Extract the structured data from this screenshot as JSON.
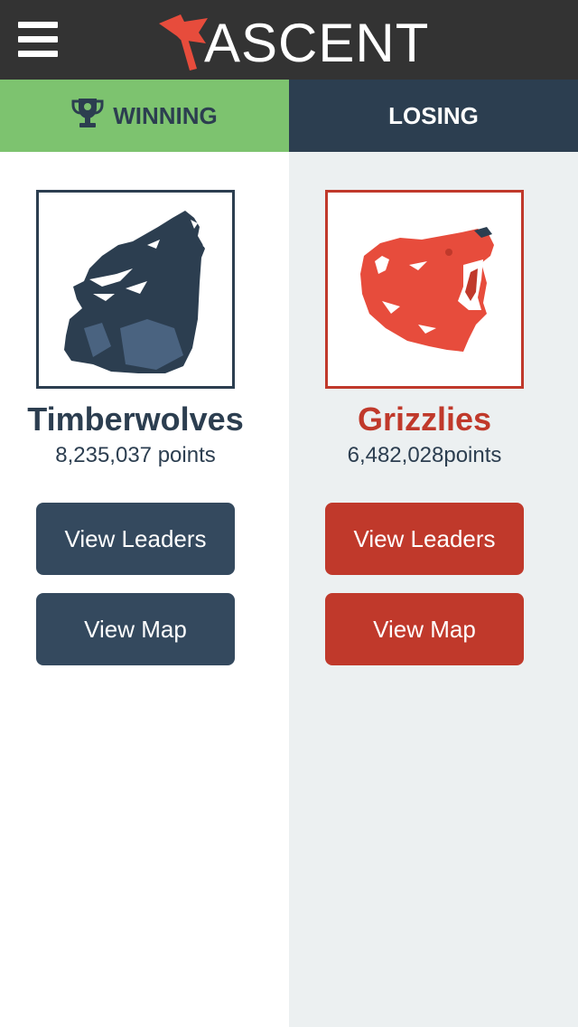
{
  "app": {
    "title": "ASCENT",
    "brand_color": "#333333",
    "logo_icon": "flag-icon",
    "menu_icon": "hamburger-menu-icon"
  },
  "tabs": {
    "winning": {
      "label": "WINNING",
      "icon": "trophy-icon",
      "color": "#7dc36f"
    },
    "losing": {
      "label": "LOSING",
      "color": "#2c3e50"
    }
  },
  "teams": [
    {
      "name": "Timberwolves",
      "points": "8,235,037 points",
      "icon": "wolf-icon",
      "color": "#2c3e50",
      "leaders_label": "View Leaders",
      "map_label": "View Map"
    },
    {
      "name": "Grizzlies",
      "points": "6,482,028points",
      "icon": "bear-icon",
      "color": "#c0392b",
      "leaders_label": "View Leaders",
      "map_label": "View Map"
    }
  ]
}
